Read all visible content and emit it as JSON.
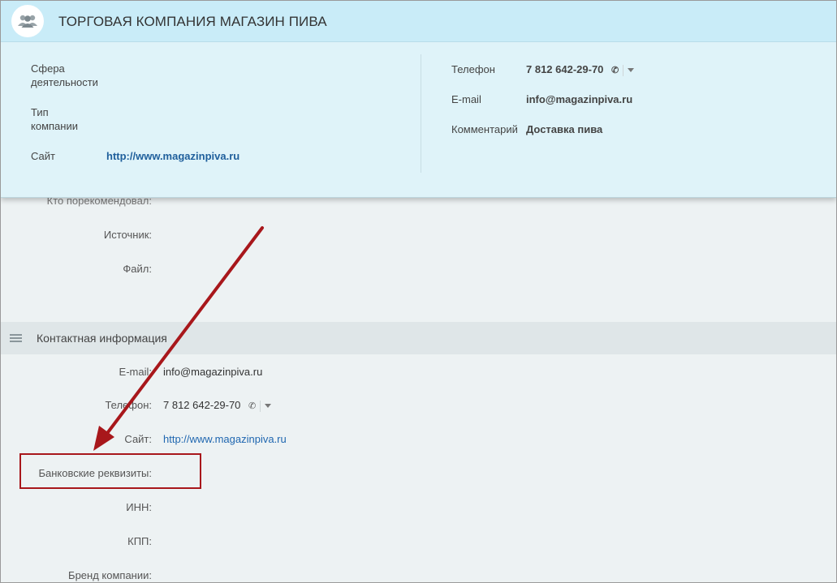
{
  "popup": {
    "title": "ТОРГОВАЯ КОМПАНИЯ МАГАЗИН ПИВА",
    "avatar_icon": "group-users-icon",
    "left": {
      "activity_label": "Сфера деятельности",
      "type_label": "Тип компании",
      "site_label": "Сайт",
      "site_value": "http://www.magazinpiva.ru"
    },
    "right": {
      "phone_label": "Телефон",
      "phone_value": "7 812 642-29-70",
      "email_label": "E-mail",
      "email_value": "info@magazinpiva.ru",
      "comment_label": "Комментарий",
      "comment_value": "Доставка пива"
    }
  },
  "form": {
    "recommended_label": "Кто порекомендовал:",
    "source_label": "Источник:",
    "file_label": "Файл:",
    "contact_section": {
      "title": "Контактная информация",
      "email_label": "E-mail:",
      "email_value": "info@magazinpiva.ru",
      "phone_label": "Телефон:",
      "phone_value": "7 812 642-29-70",
      "site_label": "Сайт:",
      "site_value": "http://www.magazinpiva.ru",
      "bank_label": "Банковские реквизиты:",
      "inn_label": "ИНН:",
      "kpp_label": "КПП:",
      "brand_label": "Бренд компании:"
    }
  },
  "colors": {
    "annotation": "#a8171b",
    "link": "#2067b0",
    "popup_bg": "#dff3f9",
    "popup_header": "#c9ecf8"
  }
}
